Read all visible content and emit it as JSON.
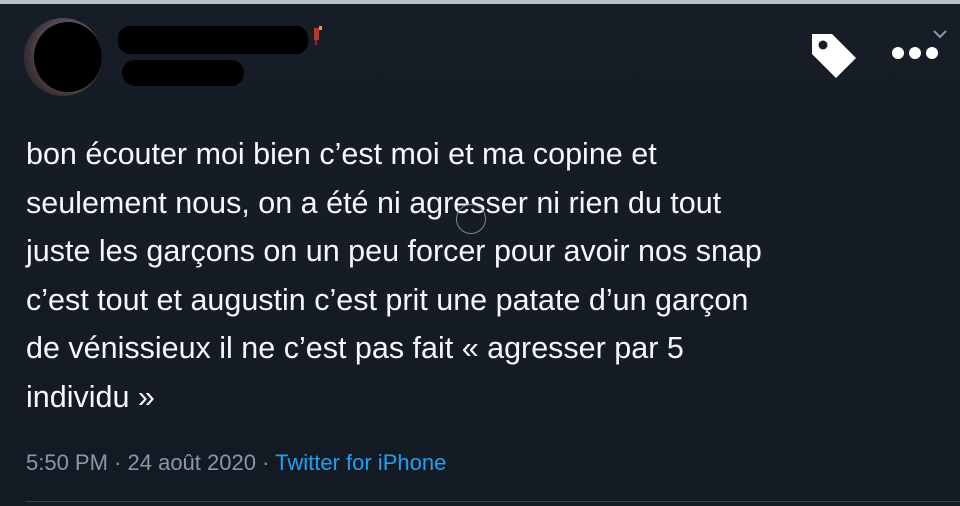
{
  "colors": {
    "background": "#15202b",
    "text": "#f5f8fa",
    "meta_text": "#8899a6",
    "link": "#1da1f2"
  },
  "header": {
    "avatar": "redacted",
    "display_name": "redacted",
    "handle": "redacted",
    "icons": [
      "tag-icon",
      "more-options-icon",
      "chevron-down-icon"
    ]
  },
  "tweet": {
    "lines": [
      "bon écouter moi bien c’est moi et ma copine et",
      "seulement nous, on a été ni agresser ni rien du tout",
      "juste les garçons on un peu forcer pour avoir nos snap",
      "c’est tout et augustin c’est prit une patate d’un garçon",
      "de vénissieux il ne c’est pas fait « agresser par 5",
      "individu »"
    ]
  },
  "meta": {
    "time": "5:50 PM",
    "separator_1": " · ",
    "date": "24 août 2020",
    "separator_2": " · ",
    "source": "Twitter for iPhone"
  }
}
